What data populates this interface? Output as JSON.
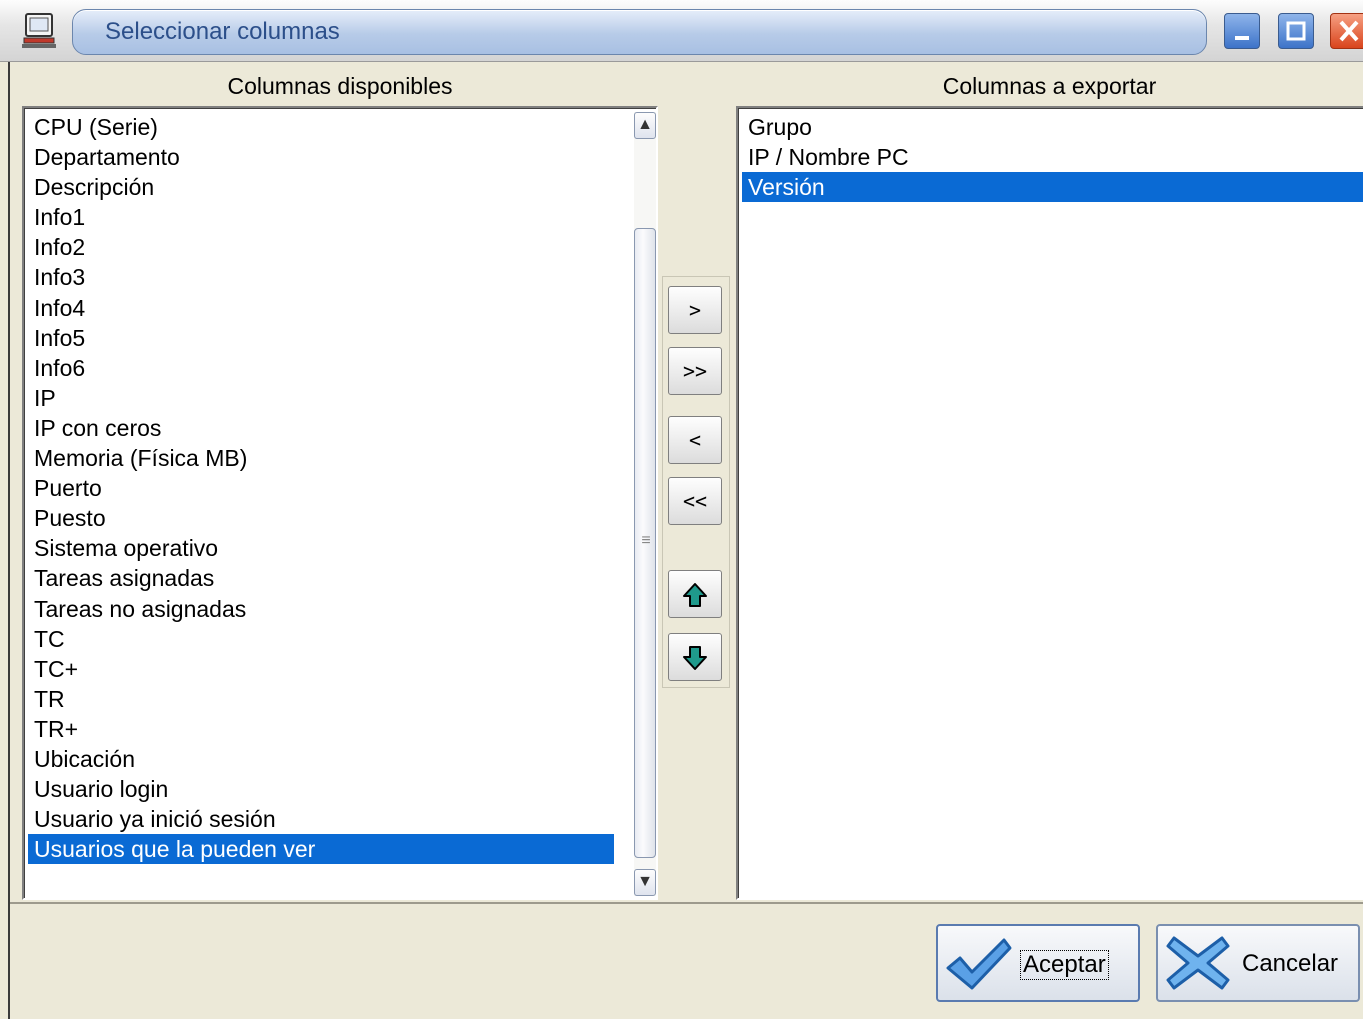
{
  "window": {
    "title": "Seleccionar columnas"
  },
  "available": {
    "header": "Columnas disponibles",
    "items": [
      "CPU (Serie)",
      "Departamento",
      "Descripción",
      "Info1",
      "Info2",
      "Info3",
      "Info4",
      "Info5",
      "Info6",
      "IP",
      "IP con ceros",
      "Memoria (Física MB)",
      "Puerto",
      "Puesto",
      "Sistema operativo",
      "Tareas asignadas",
      "Tareas no asignadas",
      "TC",
      "TC+",
      "TR",
      "TR+",
      "Ubicación",
      "Usuario login",
      "Usuario ya inició sesión",
      "Usuarios que la pueden ver"
    ],
    "selected": "Usuarios que la pueden ver"
  },
  "export": {
    "header": "Columnas a exportar",
    "items": [
      "Grupo",
      "IP / Nombre PC",
      "Versión"
    ],
    "selected": "Versión"
  },
  "transfer": {
    "add": ">",
    "add_all": ">>",
    "remove": "<",
    "remove_all": "<<"
  },
  "buttons": {
    "ok": "Aceptar",
    "cancel": "Cancelar"
  },
  "colors": {
    "selection": "#0a6ad4",
    "title_text": "#2c4f8a",
    "dialog_bg": "#ece9d8"
  },
  "icons": {
    "app": "computer-icon",
    "minimize": "minimize-icon",
    "maximize": "maximize-icon",
    "close": "close-icon",
    "move_up": "arrow-up-icon",
    "move_down": "arrow-down-icon",
    "ok": "checkmark-icon",
    "cancel": "x-icon"
  }
}
